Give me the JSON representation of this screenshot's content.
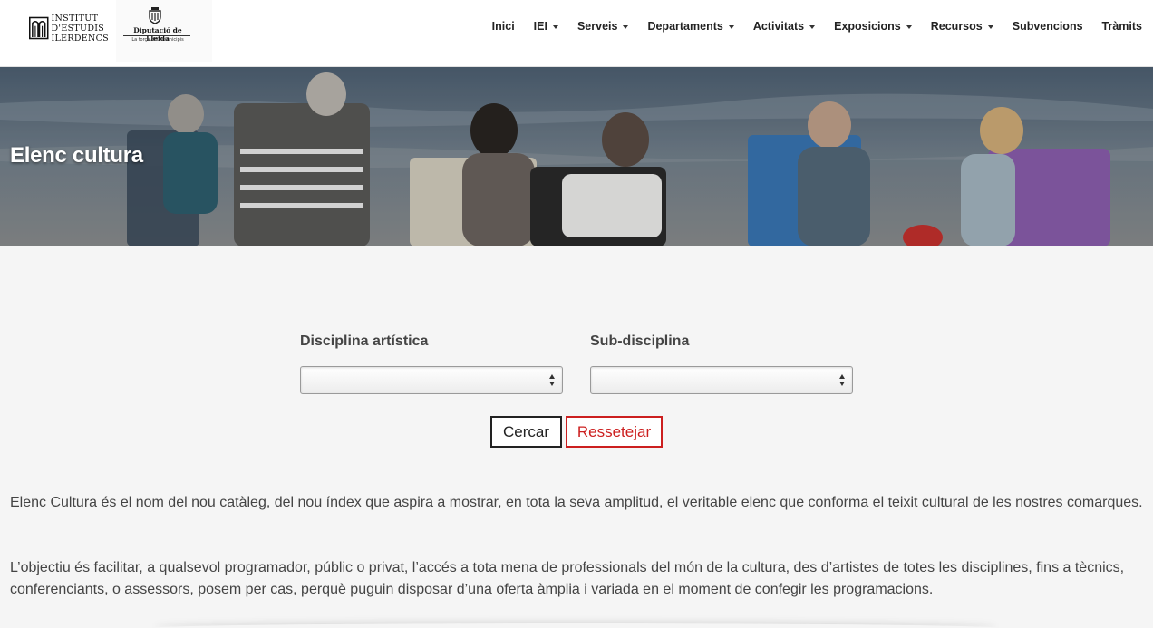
{
  "header": {
    "logo_iei_lines": [
      "INSTITUT",
      "D'ESTUDIS",
      "ILERDENCS"
    ],
    "logo_diputacio_name": "Diputació de Lleida",
    "logo_diputacio_tagline": "La força dels municipis",
    "nav": [
      {
        "label": "Inici",
        "has_dropdown": false
      },
      {
        "label": "IEI",
        "has_dropdown": true
      },
      {
        "label": "Serveis",
        "has_dropdown": true
      },
      {
        "label": "Departaments",
        "has_dropdown": true
      },
      {
        "label": "Activitats",
        "has_dropdown": true
      },
      {
        "label": "Exposicions",
        "has_dropdown": true
      },
      {
        "label": "Recursos",
        "has_dropdown": true
      },
      {
        "label": "Subvencions",
        "has_dropdown": false
      },
      {
        "label": "Tràmits",
        "has_dropdown": false
      }
    ]
  },
  "hero": {
    "title": "Elenc cultura"
  },
  "form": {
    "discipline_label": "Disciplina artística",
    "discipline_value": "",
    "subdiscipline_label": "Sub-disciplina",
    "subdiscipline_value": "",
    "search_button": "Cercar",
    "reset_button": "Ressetejar"
  },
  "content": {
    "paragraph_1": "Elenc Cultura és el nom del nou catàleg, del nou índex que aspira a mostrar, en tota la seva amplitud, el veritable elenc que conforma el teixit cultural de les nostres comarques.",
    "paragraph_2": "L’objectiu és facilitar, a qualsevol programador, públic o privat, l’accés a tota mena de professionals del món de la cultura, des d’artistes de totes les disciplines, fins a tècnics, conferenciants, o assessors, posem per cas, perquè puguin disposar d’una oferta àmplia i variada en el moment de confegir les programacions."
  },
  "colors": {
    "reset_accent": "#cc1f1f",
    "header_bg": "#ffffff",
    "page_bg": "#f5f5f5"
  },
  "icons": [
    "iei-logo-icon",
    "diputacio-shield-icon",
    "caret-down-icon",
    "select-arrows-icon"
  ]
}
